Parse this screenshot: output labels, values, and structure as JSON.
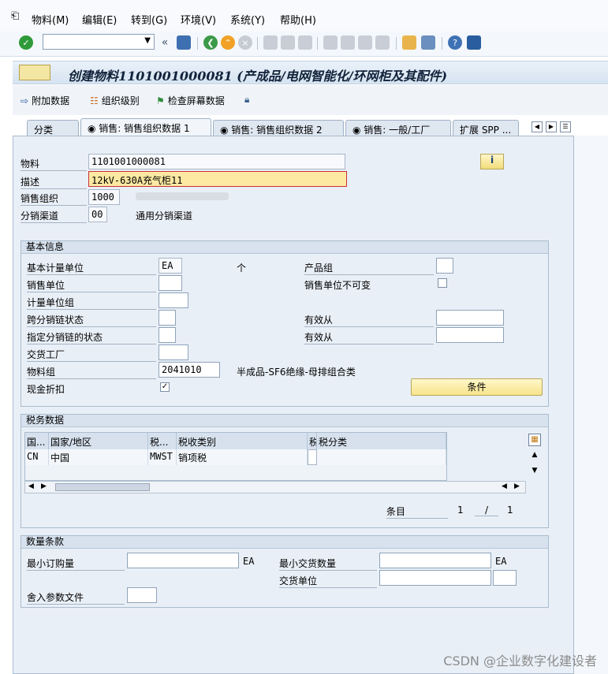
{
  "menu": {
    "items": [
      "物料(M)",
      "编辑(E)",
      "转到(G)",
      "环境(V)",
      "系统(Y)",
      "帮助(H)"
    ]
  },
  "title": "创建物料1101001000081 (产成品/电网智能化/环网柜及其配件)",
  "app_toolbar": {
    "additional_data": "附加数据",
    "org_levels": "组织级别",
    "check_screen_data": "检查屏幕数据"
  },
  "tabs": [
    "分类",
    "销售: 销售组织数据 1",
    "销售: 销售组织数据 2",
    "销售: 一般/工厂",
    "扩展 SPP ..."
  ],
  "header": {
    "material_label": "物料",
    "material_value": "1101001000081",
    "desc_label": "描述",
    "desc_value": "12kV-630A充气柜11",
    "sales_org_label": "销售组织",
    "sales_org_value": "1000",
    "dist_channel_label": "分销渠道",
    "dist_channel_value": "00",
    "dist_channel_text": "通用分销渠道"
  },
  "basic": {
    "title": "基本信息",
    "base_uom_label": "基本计量单位",
    "base_uom_value": "EA",
    "base_uom_text": "个",
    "product_group_label": "产品组",
    "sales_unit_label": "销售单位",
    "sales_unit_fixed_label": "销售单位不可变",
    "uom_group_label": "计量单位组",
    "xdist_status_label": "跨分销链状态",
    "valid_from_label_1": "有效从",
    "dchain_status_label": "指定分销链的状态",
    "valid_from_label_2": "有效从",
    "delivery_plant_label": "交货工厂",
    "material_group_label": "物料组",
    "material_group_value": "2041010",
    "material_group_text": "半成品-SF6绝缘-母排组合类",
    "cash_discount_label": "现金折扣",
    "cash_discount_checked": "✓",
    "conditions_button": "条件"
  },
  "tax": {
    "title": "税务数据",
    "columns": [
      "国...",
      "国家/地区",
      "税...",
      "税收类别",
      "税",
      "税分类"
    ],
    "rows": [
      [
        "CN",
        "中国",
        "MWST",
        "销项税",
        "",
        ""
      ]
    ],
    "entry_label": "条目",
    "entry_current": "1",
    "entry_sep": "/",
    "entry_total": "1"
  },
  "quantity": {
    "title": "数量条款",
    "min_order_label": "最小订购量",
    "min_order_unit": "EA",
    "min_delivery_label": "最小交货数量",
    "min_delivery_unit": "EA",
    "delivery_unit_label": "交货单位",
    "rounding_profile_label": "舍入参数文件"
  },
  "watermark": "CSDN @企业数字化建设者"
}
